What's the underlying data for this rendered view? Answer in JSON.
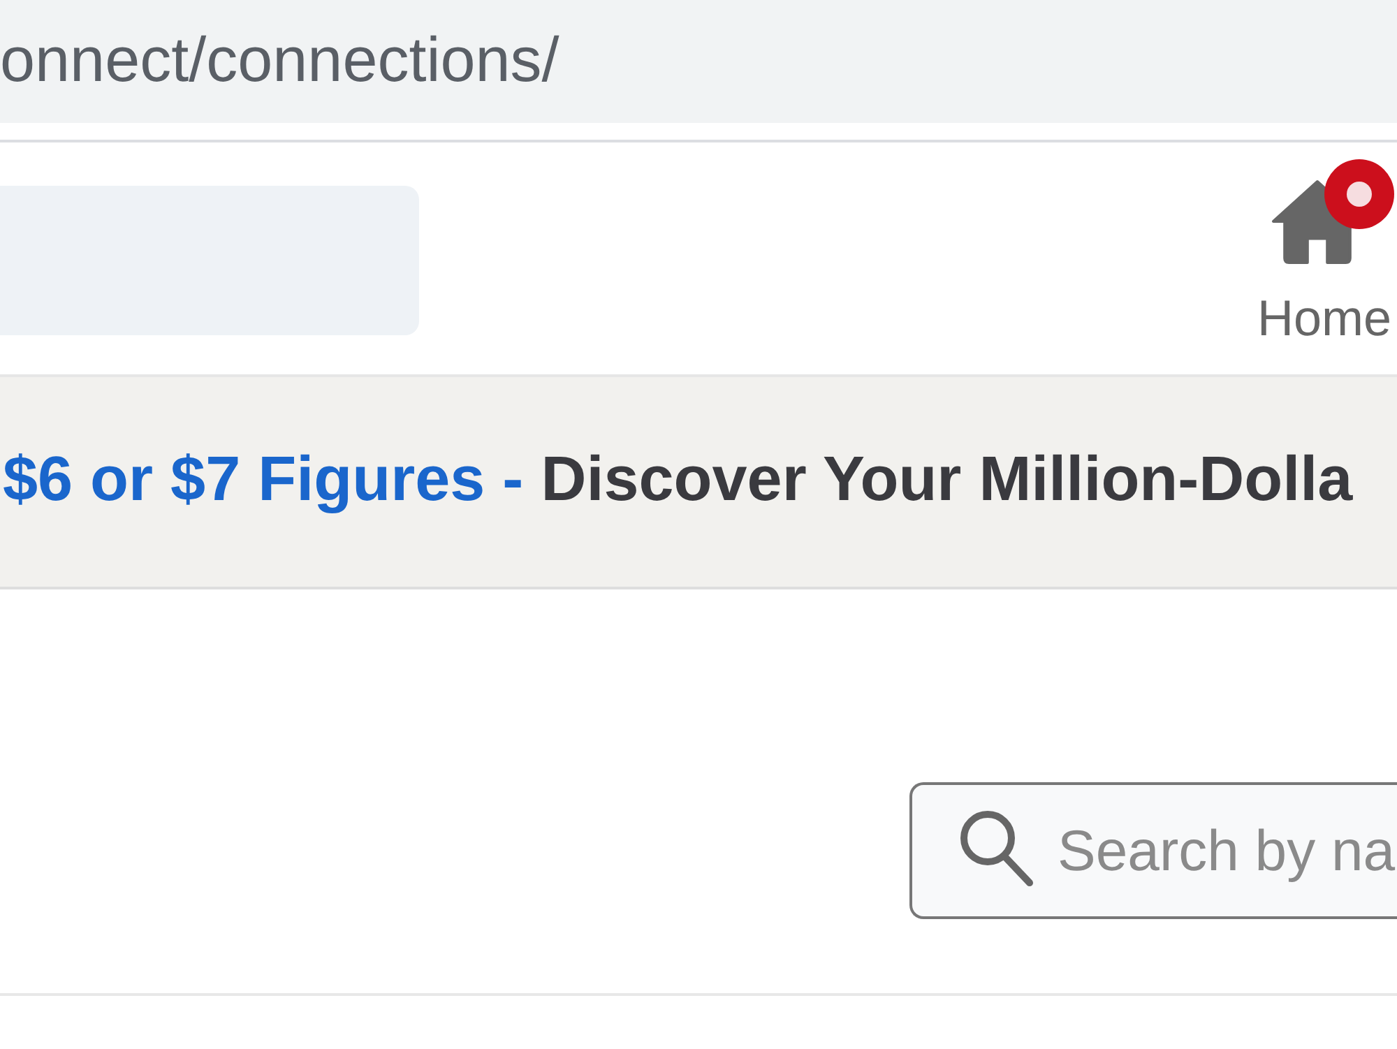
{
  "address_bar": {
    "url": "onnect/connections/"
  },
  "header": {
    "nav_items": [
      {
        "label": "Home",
        "notification": true
      }
    ]
  },
  "banner": {
    "link": "$6 or $7 Figures -",
    "headline": "Discover Your Million-Dolla"
  },
  "content": {
    "search": {
      "placeholder": "Search by na"
    }
  }
}
